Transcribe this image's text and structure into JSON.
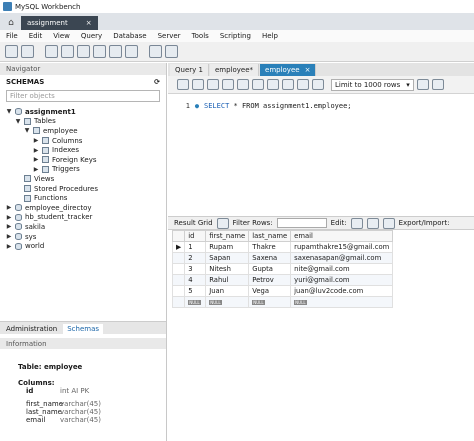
{
  "app_title": "MySQL Workbench",
  "connection_tab": "assignment",
  "menu": [
    "File",
    "Edit",
    "View",
    "Query",
    "Database",
    "Server",
    "Tools",
    "Scripting",
    "Help"
  ],
  "navigator": {
    "header": "Navigator",
    "schemas_label": "SCHEMAS",
    "filter_placeholder": "Filter objects",
    "tree": {
      "assignment1": "assignment1",
      "tables": "Tables",
      "employee": "employee",
      "columns": "Columns",
      "indexes": "Indexes",
      "foreign_keys": "Foreign Keys",
      "triggers": "Triggers",
      "views": "Views",
      "stored_procedures": "Stored Procedures",
      "functions": "Functions",
      "employee_directory": "employee_directoy",
      "hb_student_tracker": "hb_student_tracker",
      "sakila": "sakila",
      "sys": "sys",
      "world": "world"
    },
    "tabs": {
      "administration": "Administration",
      "schemas": "Schemas"
    },
    "information_header": "Information",
    "info": {
      "table_label": "Table: employee",
      "columns_label": "Columns:",
      "columns": [
        {
          "name": "id",
          "type": "int AI PK"
        },
        {
          "name": "first_name",
          "type": "varchar(45)"
        },
        {
          "name": "last_name",
          "type": "varchar(45)"
        },
        {
          "name": "email",
          "type": "varchar(45)"
        }
      ]
    }
  },
  "query_tabs": {
    "query1": "Query 1",
    "employee_modified": "employee*",
    "employee": "employee"
  },
  "editor": {
    "limit_label": "Limit to 1000 rows",
    "line_number": "1",
    "sql_keyword": "SELECT",
    "sql_rest": " * FROM assignment1.employee;"
  },
  "result_toolbar": {
    "result_grid": "Result Grid",
    "filter_rows": "Filter Rows:",
    "edit": "Edit:",
    "export": "Export/Import:"
  },
  "grid": {
    "columns": [
      "id",
      "first_name",
      "last_name",
      "email"
    ],
    "rows": [
      [
        "1",
        "Rupam",
        "Thakre",
        "rupamthakre15@gmail.com"
      ],
      [
        "2",
        "Sapan",
        "Saxena",
        "saxenasapan@gmail.com"
      ],
      [
        "3",
        "Nitesh",
        "Gupta",
        "nite@gmail.com"
      ],
      [
        "4",
        "Rahul",
        "Petrov",
        "yuri@gmail.com"
      ],
      [
        "5",
        "Juan",
        "Vega",
        "juan@luv2code.com"
      ]
    ],
    "null_label": "NULL"
  }
}
